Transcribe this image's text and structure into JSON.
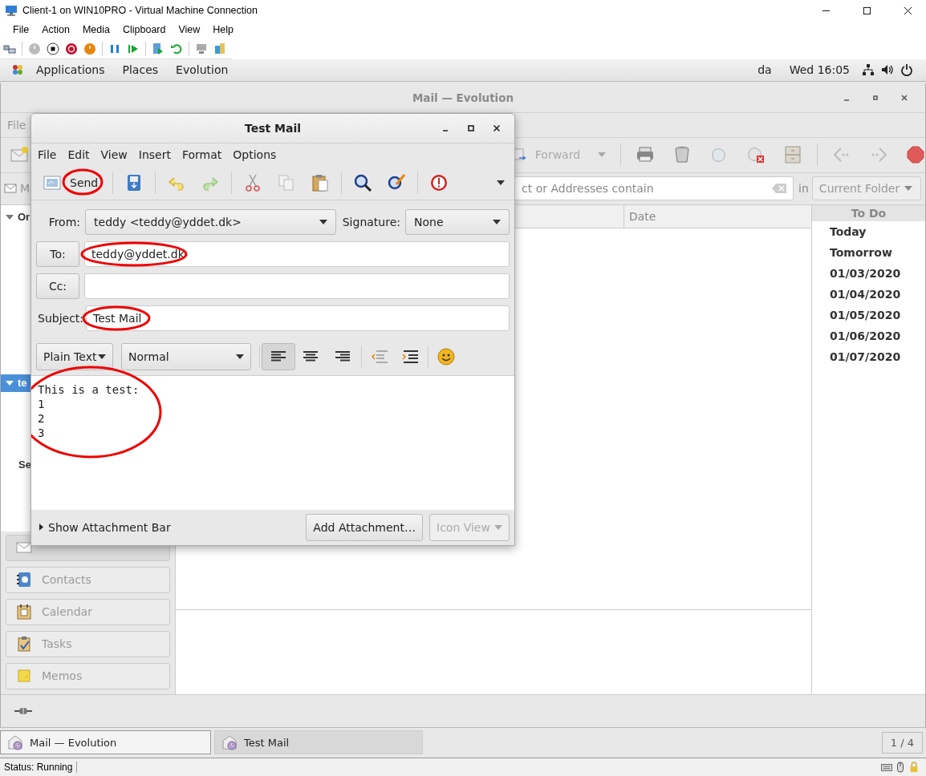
{
  "vm_window": {
    "title": "Client-1 on WIN10PRO - Virtual Machine Connection",
    "menu": [
      "File",
      "Action",
      "Media",
      "Clipboard",
      "View",
      "Help"
    ],
    "status": "Status: Running"
  },
  "top_bar": {
    "menus": [
      "Applications",
      "Places",
      "Evolution"
    ],
    "keyboard": "da",
    "clock": "Wed 16:05"
  },
  "evolution": {
    "title": "Mail — Evolution",
    "menu": [
      "File"
    ],
    "forward": "Forward",
    "view_prefix": "M",
    "search": "ct or Addresses contain",
    "scope_label": "in",
    "scope": "Current Folder",
    "folders": [
      {
        "kind": "account",
        "label": "Or",
        "selected": false
      },
      {
        "kind": "account",
        "label": "te",
        "selected": true
      },
      {
        "kind": "heading",
        "label": "Se",
        "selected": false
      }
    ],
    "columns": [
      "Date"
    ],
    "todo": {
      "title": "To Do",
      "items": [
        "Today",
        "Tomorrow",
        "01/03/2020",
        "01/04/2020",
        "01/05/2020",
        "01/06/2020",
        "01/07/2020"
      ]
    },
    "switcher": [
      {
        "kind": "mail",
        "selected": true
      },
      {
        "kind": "contacts",
        "label": "Contacts",
        "selected": false
      },
      {
        "kind": "calendar",
        "label": "Calendar",
        "selected": false
      },
      {
        "kind": "tasks",
        "label": "Tasks",
        "selected": false
      },
      {
        "kind": "memos",
        "label": "Memos",
        "selected": false
      }
    ]
  },
  "compose": {
    "title": "Test Mail",
    "menu": [
      "File",
      "Edit",
      "View",
      "Insert",
      "Format",
      "Options"
    ],
    "send": {
      "label": "Send",
      "circled": true
    },
    "from_label": "From:",
    "from": "teddy <teddy@yddet.dk>",
    "signature_label": "Signature:",
    "signature": "None",
    "to": {
      "button": "To:",
      "value": "teddy@yddet.dk",
      "circled": true
    },
    "cc": {
      "button": "Cc:"
    },
    "subject": {
      "label": "Subject:",
      "value": "Test Mail",
      "circled": true
    },
    "format_mode": "Plain Text",
    "paragraph_style": "Normal",
    "alignment": [
      {
        "kind": "left",
        "selected": true
      },
      {
        "kind": "center",
        "selected": false
      },
      {
        "kind": "right",
        "selected": false
      }
    ],
    "body": {
      "lines": [
        "This is a test:",
        "1",
        "2",
        "3"
      ],
      "circled": true
    },
    "attachment_toggle": "Show Attachment Bar",
    "add_attachment": "Add Attachment…",
    "view_mode": {
      "label": "Icon View",
      "disabled": true
    }
  },
  "taskbar": [
    {
      "label": "Mail — Evolution",
      "selected": false
    },
    {
      "label": "Test Mail",
      "selected": true
    }
  ],
  "workspace": "1 / 4"
}
